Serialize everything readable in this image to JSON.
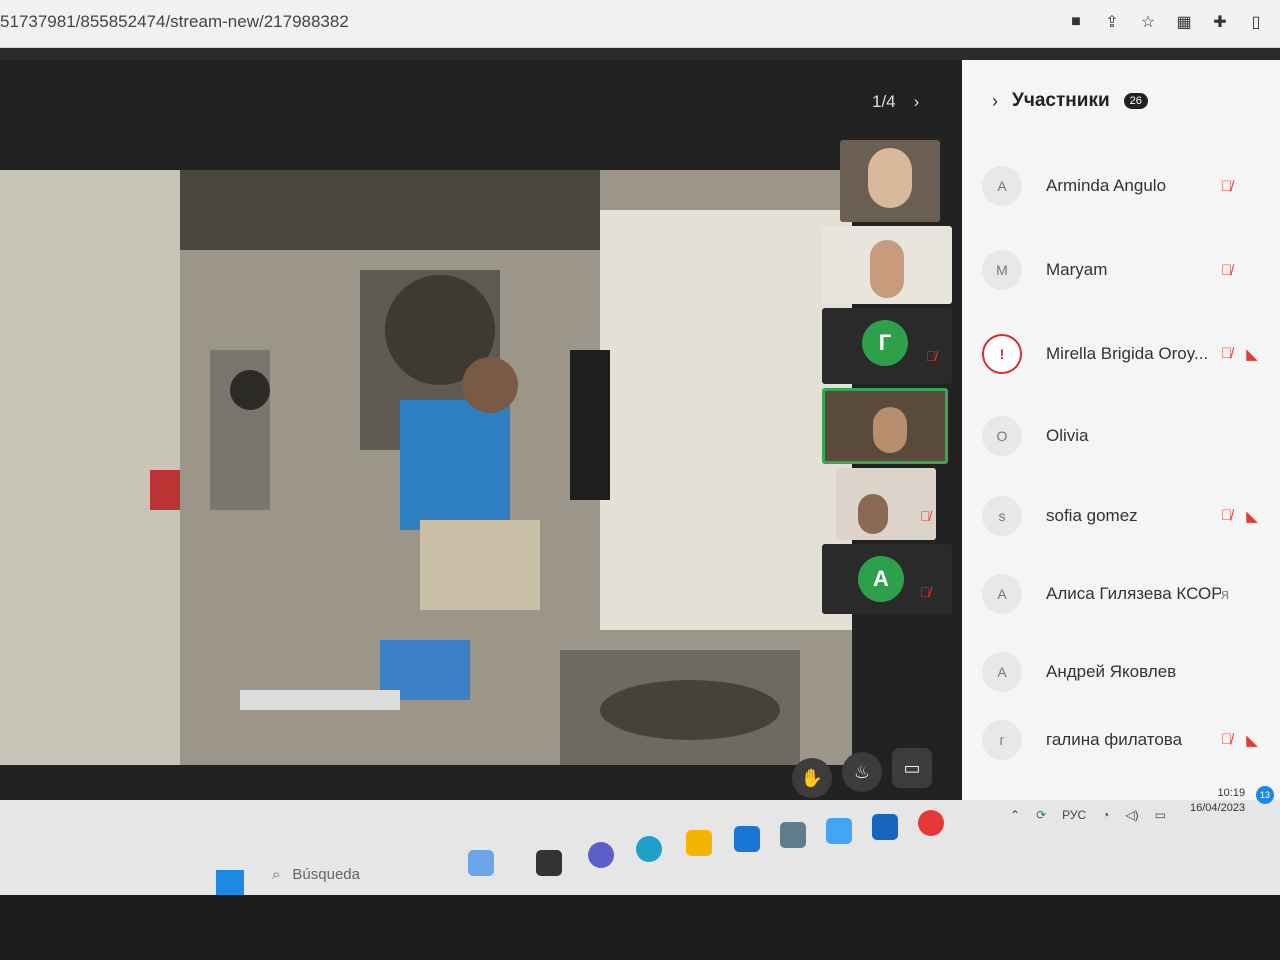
{
  "browser": {
    "url": "51737981/855852474/stream-new/217988382"
  },
  "video": {
    "pager_text": "1/4",
    "tiles": [
      {
        "type": "video"
      },
      {
        "type": "video"
      },
      {
        "type": "avatar",
        "letter": "Г"
      },
      {
        "type": "video",
        "active": true
      },
      {
        "type": "video"
      },
      {
        "type": "avatar",
        "letter": "А"
      }
    ]
  },
  "participants": {
    "title": "Участники",
    "count": "26",
    "list": [
      {
        "initial": "A",
        "name": "Arminda Angulo",
        "mic_off": true,
        "cam_off": false
      },
      {
        "initial": "M",
        "name": "Maryam",
        "mic_off": true,
        "cam_off": false
      },
      {
        "initial": "!",
        "name": "Mirella Brigida Oroy...",
        "mic_off": true,
        "cam_off": true,
        "warn": true
      },
      {
        "initial": "O",
        "name": "Olivia",
        "mic_off": false,
        "cam_off": false
      },
      {
        "initial": "s",
        "name": "sofia gomez",
        "mic_off": true,
        "cam_off": true
      },
      {
        "initial": "А",
        "name": "Алиса Гилязева КСОР...",
        "suffix": "я",
        "mic_off": false,
        "cam_off": false
      },
      {
        "initial": "А",
        "name": "Андрей Яковлев",
        "mic_off": false,
        "cam_off": false
      },
      {
        "initial": "г",
        "name": "галина филатова",
        "mic_off": true,
        "cam_off": true
      }
    ]
  },
  "taskbar": {
    "search_placeholder": "Búsqueda",
    "lang": "РУС",
    "time": "10:19",
    "date": "16/04/2023",
    "notification_count": "13"
  },
  "colors": {
    "accent_green": "#34a853",
    "mute_red": "#e53935",
    "panel_bg": "#f5f5f5"
  }
}
